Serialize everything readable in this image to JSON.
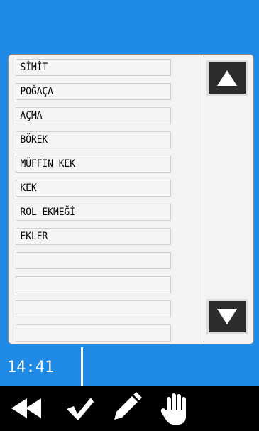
{
  "list": {
    "items": [
      "SİMİT",
      "POĞAÇA",
      "AÇMA",
      "BÖREK",
      "MÜFFİN KEK",
      "KEK",
      "ROL EKMEĞİ",
      "EKLER",
      "",
      "",
      "",
      ""
    ]
  },
  "scroll": {
    "up_icon": "triangle-up-icon",
    "down_icon": "triangle-down-icon"
  },
  "status": {
    "time": "14:41"
  },
  "toolbar": {
    "icons": [
      "rewind-icon",
      "checkmark-icon",
      "pencil-icon",
      "hand-icon"
    ]
  },
  "colors": {
    "accent": "#1e8ae6",
    "toolbar_bg": "#000000",
    "button_bg": "#2c2c2c"
  }
}
